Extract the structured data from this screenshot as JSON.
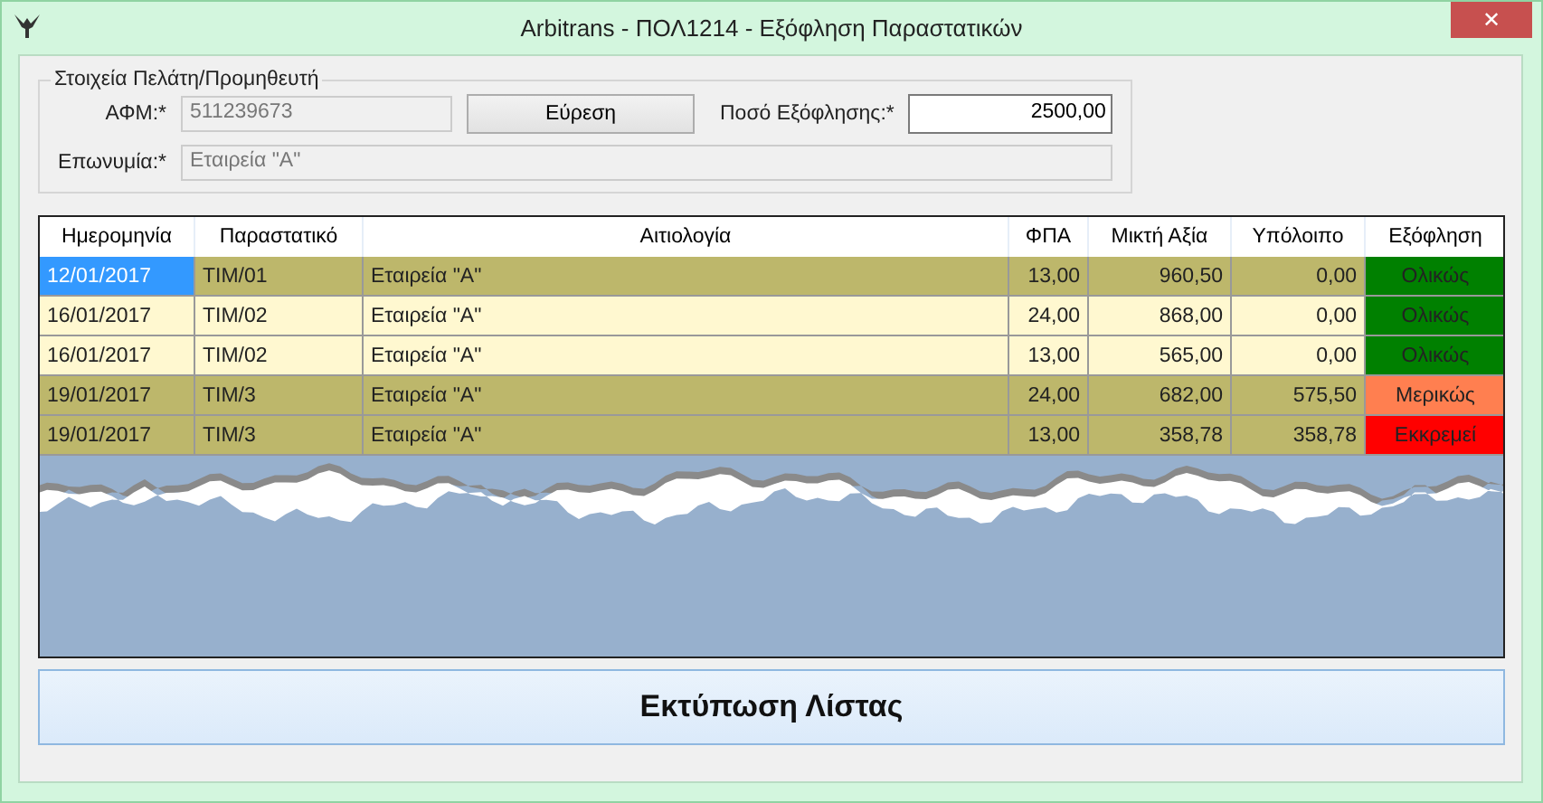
{
  "window": {
    "title": "Arbitrans - ΠΟΛ1214 - Εξόφληση Παραστατικών",
    "close": "✕"
  },
  "customer": {
    "legend": "Στοιχεία Πελάτη/Προμηθευτή",
    "afm_label": "ΑΦΜ:*",
    "afm_value": "511239673",
    "find_button": "Εύρεση",
    "amount_label": "Ποσό Εξόφλησης:*",
    "amount_value": "2500,00",
    "name_label": "Επωνυμία:*",
    "name_value": "Εταιρεία \"Α\""
  },
  "table": {
    "columns": [
      "Ημερομηνία",
      "Παραστατικό",
      "Αιτιολογία",
      "ΦΠΑ",
      "Μικτή Αξία",
      "Υπόλοιπο",
      "Εξόφληση"
    ],
    "rows": [
      {
        "date": "12/01/2017",
        "doc": "TIM/01",
        "reason": "Εταιρεία \"Α\"",
        "vat": "13,00",
        "gross": "960,50",
        "balance": "0,00",
        "status": {
          "label": "Ολικώς",
          "color": "#008000"
        },
        "color": "#bdb76b",
        "selected": true
      },
      {
        "date": "16/01/2017",
        "doc": "TIM/02",
        "reason": "Εταιρεία \"Α\"",
        "vat": "24,00",
        "gross": "868,00",
        "balance": "0,00",
        "status": {
          "label": "Ολικώς",
          "color": "#008000"
        },
        "color": "#fff8d0",
        "selected": false
      },
      {
        "date": "16/01/2017",
        "doc": "TIM/02",
        "reason": "Εταιρεία \"Α\"",
        "vat": "13,00",
        "gross": "565,00",
        "balance": "0,00",
        "status": {
          "label": "Ολικώς",
          "color": "#008000"
        },
        "color": "#fff8d0",
        "selected": false
      },
      {
        "date": "19/01/2017",
        "doc": "TIM/3",
        "reason": "Εταιρεία \"Α\"",
        "vat": "24,00",
        "gross": "682,00",
        "balance": "575,50",
        "status": {
          "label": "Μερικώς",
          "color": "#ff7f50"
        },
        "color": "#bdb76b",
        "selected": false
      },
      {
        "date": "19/01/2017",
        "doc": "TIM/3",
        "reason": "Εταιρεία \"Α\"",
        "vat": "13,00",
        "gross": "358,78",
        "balance": "358,78",
        "status": {
          "label": "Εκκρεμεί",
          "color": "#ff0000"
        },
        "color": "#bdb76b",
        "selected": false
      }
    ]
  },
  "print_button": "Εκτύπωση Λίστας"
}
